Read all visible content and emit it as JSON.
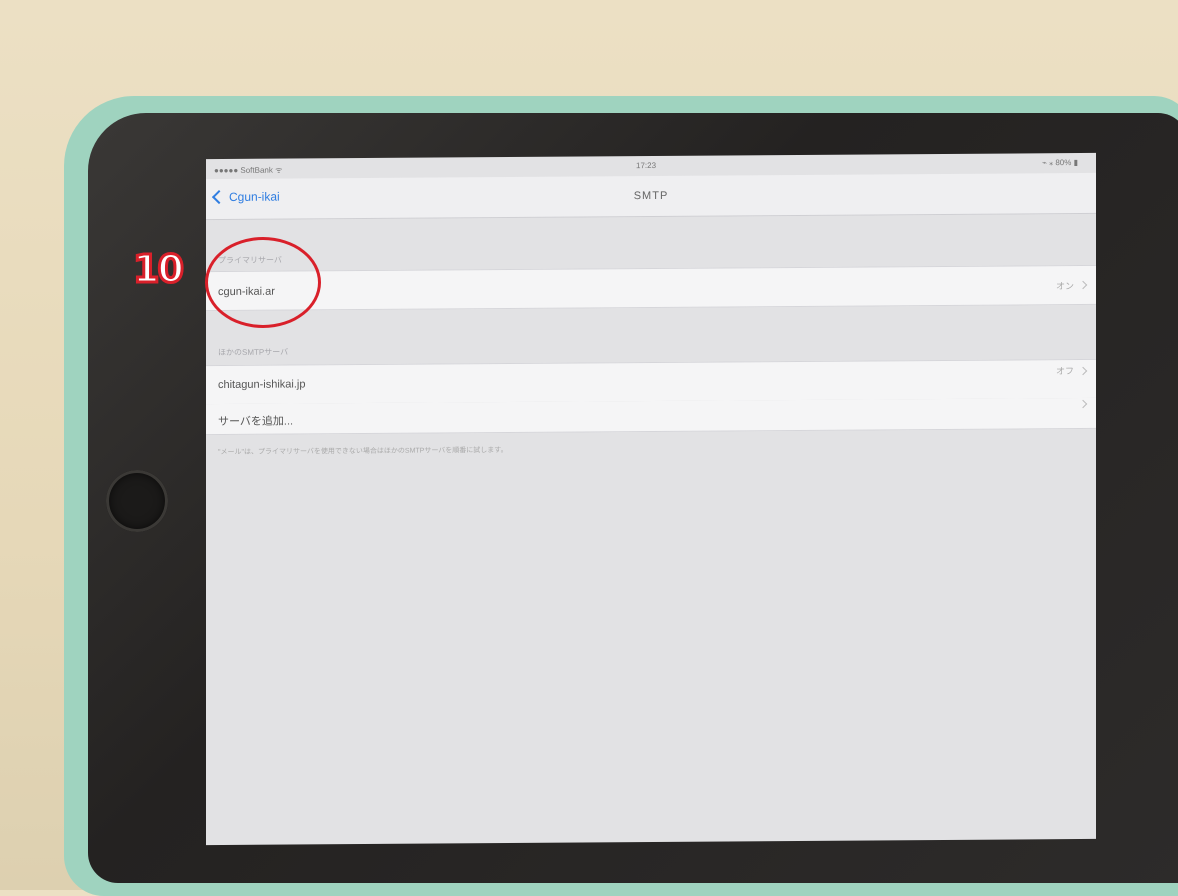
{
  "status_bar": {
    "carrier": "●●●●● SoftBank ᯤ",
    "time": "17:23",
    "battery": "⌁ ⁎ 80% ▮"
  },
  "nav": {
    "back_label": "Cgun-ikai",
    "title": "SMTP"
  },
  "primary_section": {
    "header": "プライマリサーバ",
    "server": "cgun-ikai.ar",
    "status": "オン"
  },
  "other_section": {
    "header": "ほかのSMTPサーバ",
    "servers": [
      {
        "name": "chitagun-ishikai.jp",
        "status": "オフ"
      }
    ],
    "add_label": "サーバを追加..."
  },
  "footer": "\"メール\"は、プライマリサーバを使用できない場合はほかのSMTPサーバを順番に試します。",
  "annotation": {
    "number": "10",
    "color": "#d9202a"
  },
  "colors": {
    "accent": "#2f7de1"
  }
}
